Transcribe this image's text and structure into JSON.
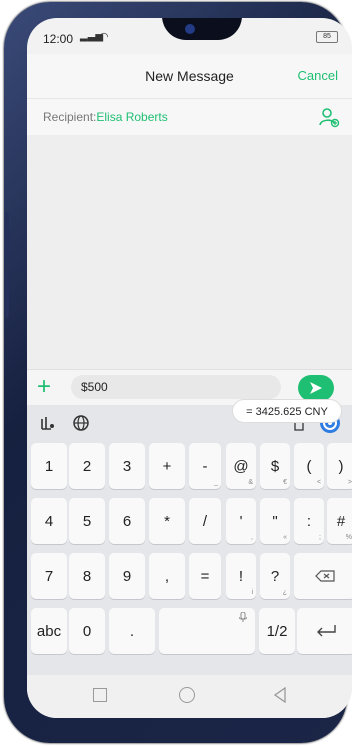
{
  "status": {
    "time": "12:00",
    "battery": "85"
  },
  "header": {
    "title": "New Message",
    "cancel_label": "Cancel"
  },
  "recipient": {
    "label": "Recipient:",
    "name": "Elisa Roberts"
  },
  "composer": {
    "value": "$500"
  },
  "conversion": {
    "text": "= 3425.625 CNY"
  },
  "keyboard": {
    "row1": [
      {
        "main": "1"
      },
      {
        "main": "2"
      },
      {
        "main": "3"
      },
      {
        "main": "+"
      },
      {
        "main": "-",
        "sub": "_"
      },
      {
        "main": "@",
        "sub": "&"
      },
      {
        "main": "$",
        "sub": "€"
      },
      {
        "main": "(",
        "sub": "<"
      },
      {
        "main": ")",
        "sub": ">"
      }
    ],
    "row2": [
      {
        "main": "4"
      },
      {
        "main": "5"
      },
      {
        "main": "6"
      },
      {
        "main": "*"
      },
      {
        "main": "/"
      },
      {
        "main": "'",
        "sub": ","
      },
      {
        "main": "\"",
        "sub": "«"
      },
      {
        "main": ":",
        "sub": ";"
      },
      {
        "main": "#",
        "sub": "%"
      }
    ],
    "row3": [
      {
        "main": "7"
      },
      {
        "main": "8"
      },
      {
        "main": "9"
      },
      {
        "main": ","
      },
      {
        "main": "="
      },
      {
        "main": "!",
        "sub": "i"
      },
      {
        "main": "?",
        "sub": "¿"
      }
    ],
    "abc": "abc",
    "zero": "0",
    "dot": ".",
    "half": "1/2"
  }
}
